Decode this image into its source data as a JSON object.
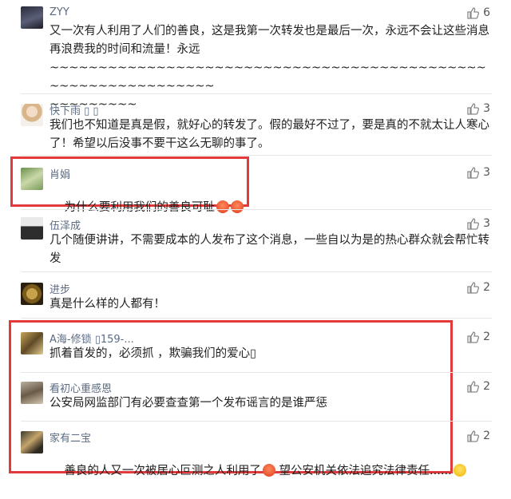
{
  "comments": [
    {
      "name": "ZYY",
      "text": "又一次有人利用了人们的善良，这是我第一次转发也是最后一次，永远不会让这些消息再浪费我的时间和流量！永远\n~~~~~~~~~~~~~~~~~~~~~~~~~~~~~~~~~~~~~~~~~~~~~~~~~~~~~~~~~~~~~~\n~~~~~~~~~",
      "likes": "6"
    },
    {
      "name": "快下雨 ▯ ▯",
      "text": "我们也不知道是真是假，就好心的转发了。假的最好不过了，要是真的不就太让人寒心了！希望以后没事不要干这么无聊的事了。",
      "likes": "3"
    },
    {
      "name": "肖娟",
      "text": "为什么要利用我们的善良可耻",
      "likes": "3"
    },
    {
      "name": "伍泽成",
      "text": "几个随便讲讲，不需要成本的人发布了这个消息，一些自以为是的热心群众就会帮忙转发",
      "likes": "3"
    },
    {
      "name": "进步",
      "text": "真是什么样的人都有！",
      "likes": "2"
    },
    {
      "name": "A海-修锁 ▯159-...",
      "text": "抓着首发的，必须抓 ，欺骗我们的爱心▯",
      "likes": "2"
    },
    {
      "name": "看初心重感恩",
      "text": "公安局网监部门有必要查查第一个发布谣言的是谁严惩",
      "likes": "2"
    },
    {
      "name": "家有二宝",
      "text": "善良的人又一次被居心叵测之人利用了",
      "text_after": "望公安机关依法追究法律责任......",
      "likes": "2"
    }
  ],
  "colors": {
    "highlight": "#e23a3a",
    "name": "#5b6b82",
    "text": "#1f1f1f"
  },
  "icons": {
    "like": "thumbs-up-icon",
    "angry": "angry-face-emoji",
    "laugh": "laughing-face-emoji"
  }
}
